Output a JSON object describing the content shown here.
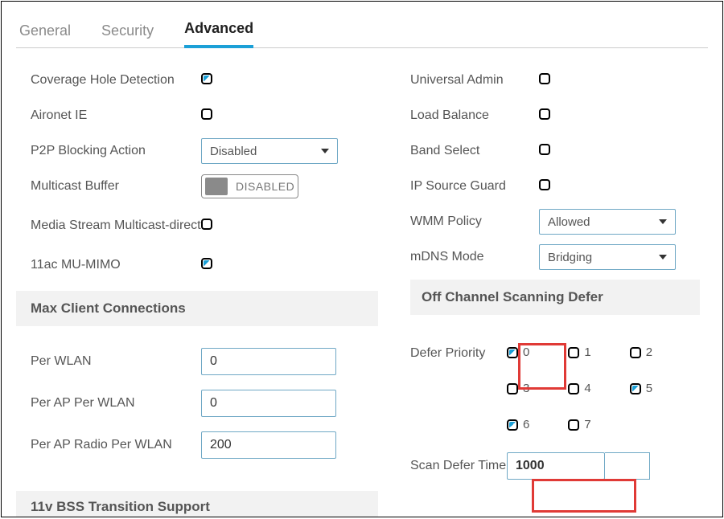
{
  "tabs": {
    "general": "General",
    "security": "Security",
    "advanced": "Advanced"
  },
  "left": {
    "coverage_hole": {
      "label": "Coverage Hole Detection",
      "checked": true
    },
    "aironet_ie": {
      "label": "Aironet IE",
      "checked": false
    },
    "p2p_blocking": {
      "label": "P2P Blocking Action",
      "value": "Disabled"
    },
    "multicast_buf": {
      "label": "Multicast Buffer",
      "toggle": "DISABLED"
    },
    "media_stream": {
      "label": "Media Stream Multicast-direct",
      "checked": false
    },
    "mu_mimo": {
      "label": "11ac MU-MIMO",
      "checked": true
    },
    "section_max": "Max Client Connections",
    "per_wlan": {
      "label": "Per WLAN",
      "value": "0"
    },
    "per_ap_wlan": {
      "label": "Per AP Per WLAN",
      "value": "0"
    },
    "per_ap_radio": {
      "label": "Per AP Radio Per WLAN",
      "value": "200"
    },
    "section_11v": "11v BSS Transition Support"
  },
  "right": {
    "universal_admin": {
      "label": "Universal Admin",
      "checked": false
    },
    "load_balance": {
      "label": "Load Balance",
      "checked": false
    },
    "band_select": {
      "label": "Band Select",
      "checked": false
    },
    "ip_src_guard": {
      "label": "IP Source Guard",
      "checked": false
    },
    "wmm_policy": {
      "label": "WMM Policy",
      "value": "Allowed"
    },
    "mdns_mode": {
      "label": "mDNS Mode",
      "value": "Bridging"
    },
    "section_off": "Off Channel Scanning Defer",
    "defer_priority": {
      "label": "Defer Priority",
      "opts": [
        {
          "n": "0",
          "checked": true
        },
        {
          "n": "1",
          "checked": false
        },
        {
          "n": "2",
          "checked": false
        },
        {
          "n": "3",
          "checked": false
        },
        {
          "n": "4",
          "checked": false
        },
        {
          "n": "5",
          "checked": true
        },
        {
          "n": "6",
          "checked": true
        },
        {
          "n": "7",
          "checked": false
        }
      ]
    },
    "scan_defer": {
      "label": "Scan Defer Time",
      "value": "1000"
    }
  }
}
